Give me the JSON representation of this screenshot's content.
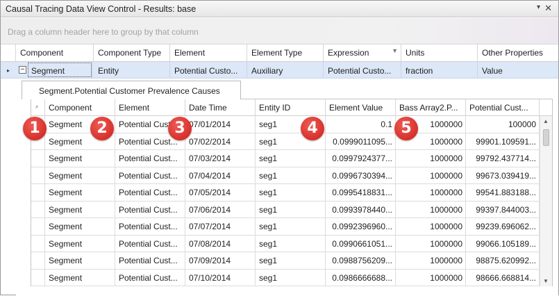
{
  "window": {
    "title": "Causal Tracing Data View Control - Results: base",
    "chevron_icon": "chevron-down-icon",
    "close_icon": "close-icon",
    "close_glyph": "✕",
    "chevron_glyph": "▾"
  },
  "group_panel": {
    "hint": "Drag a column header here to group by that column"
  },
  "outer_grid": {
    "headers": [
      "Component",
      "Component Type",
      "Element",
      "Element Type",
      "Expression",
      "Units",
      "Other Properties"
    ],
    "row": {
      "expander": "−",
      "indicator": "▸",
      "cells": [
        "Segment",
        "Entity",
        "Potential Custo...",
        "Auxiliary",
        "Potential Custo...",
        "fraction",
        "Value"
      ]
    }
  },
  "detail": {
    "tab_label": "Segment.Potential Customer Prevalence Causes",
    "corner_icon": "search-icon",
    "corner_glyph": "🔍",
    "headers": [
      "Component",
      "Element",
      "Date Time",
      "Entity ID",
      "Element Value",
      "Bass Array2.P...",
      "Potential Cust..."
    ],
    "rows": [
      [
        "Segment",
        "Potential Cust...",
        "07/01/2014",
        "seg1",
        "0.1",
        "1000000",
        "100000"
      ],
      [
        "Segment",
        "Potential Cust...",
        "07/02/2014",
        "seg1",
        "0.0999011095...",
        "1000000",
        "99901.109591..."
      ],
      [
        "Segment",
        "Potential Cust...",
        "07/03/2014",
        "seg1",
        "0.0997924377...",
        "1000000",
        "99792.437714..."
      ],
      [
        "Segment",
        "Potential Cust...",
        "07/04/2014",
        "seg1",
        "0.0996730394...",
        "1000000",
        "99673.039419..."
      ],
      [
        "Segment",
        "Potential Cust...",
        "07/05/2014",
        "seg1",
        "0.0995418831...",
        "1000000",
        "99541.883188..."
      ],
      [
        "Segment",
        "Potential Cust...",
        "07/06/2014",
        "seg1",
        "0.0993978440...",
        "1000000",
        "99397.844003..."
      ],
      [
        "Segment",
        "Potential Cust...",
        "07/07/2014",
        "seg1",
        "0.0992396960...",
        "1000000",
        "99239.696062..."
      ],
      [
        "Segment",
        "Potential Cust...",
        "07/08/2014",
        "seg1",
        "0.0990661051...",
        "1000000",
        "99066.105189..."
      ],
      [
        "Segment",
        "Potential Cust...",
        "07/09/2014",
        "seg1",
        "0.0988756209...",
        "1000000",
        "98875.620992..."
      ],
      [
        "Segment",
        "Potential Cust...",
        "07/10/2014",
        "seg1",
        "0.0986666688...",
        "1000000",
        "98666.668814..."
      ]
    ],
    "scroll_up_glyph": "▲",
    "scroll_down_glyph": "▼"
  },
  "badges": [
    "1",
    "2",
    "3",
    "4",
    "5"
  ],
  "colors": {
    "selected_row": "#dce7f7",
    "badge": "#d7302a",
    "hint_text": "#a3a3a3"
  }
}
